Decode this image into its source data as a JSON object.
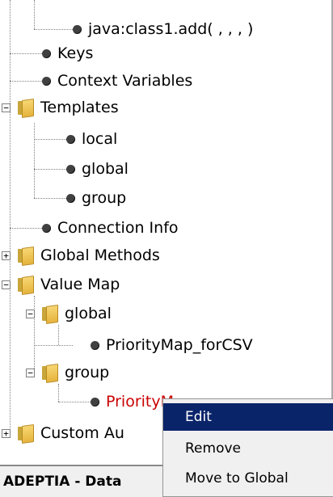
{
  "tree": {
    "items": [
      {
        "label": "java:class1.add( , , , )",
        "icon": "bullet-icon"
      },
      {
        "label": "Keys",
        "icon": "bullet-icon"
      },
      {
        "label": "Context Variables",
        "icon": "bullet-icon"
      },
      {
        "label": "Templates",
        "icon": "folder-icon",
        "expander": "−"
      },
      {
        "label": "local",
        "icon": "bullet-icon"
      },
      {
        "label": "global",
        "icon": "bullet-icon"
      },
      {
        "label": "group",
        "icon": "bullet-icon"
      },
      {
        "label": "Connection Info",
        "icon": "bullet-icon"
      },
      {
        "label": "Global Methods",
        "icon": "folder-icon",
        "expander": "+"
      },
      {
        "label": "Value Map",
        "icon": "folder-icon",
        "expander": "−"
      },
      {
        "label": "global",
        "icon": "folder-icon",
        "expander": "−"
      },
      {
        "label": "PriorityMap_forCSV",
        "icon": "bullet-icon"
      },
      {
        "label": "group",
        "icon": "folder-icon",
        "expander": "−"
      },
      {
        "label": "PriorityM",
        "icon": "bullet-icon",
        "color": "#cc0000"
      },
      {
        "label": "Custom Au",
        "icon": "folder-icon",
        "expander": "+"
      }
    ]
  },
  "status_bar": {
    "text": "ADEPTIA - Data"
  },
  "context_menu": {
    "items": [
      {
        "label": "Edit",
        "highlighted": true
      },
      {
        "label": "Remove"
      },
      {
        "label": "Move to Global"
      }
    ],
    "highlight_color": "#0a246a"
  }
}
